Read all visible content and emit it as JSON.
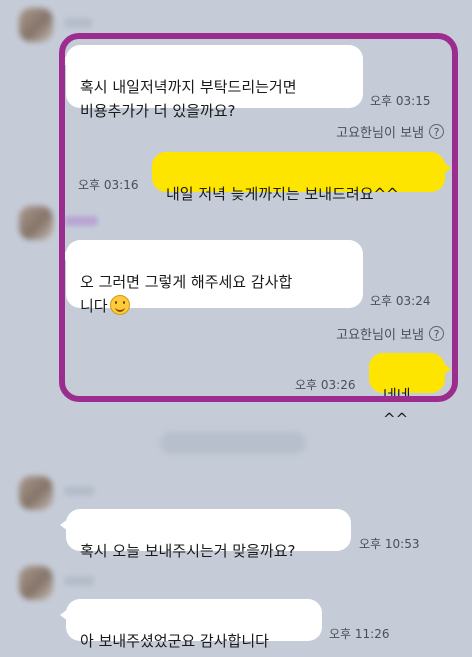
{
  "chat": {
    "messages": [
      {
        "sender": "other",
        "text": "혹시 내일저녁까지 부탁드리는거면\n비용추가가 더 있을까요?",
        "time": "오후 03:15"
      },
      {
        "sender": "me",
        "note": "고요한님이 보냄",
        "text": "내일 저녁 늦게까지는 보내드려요^^",
        "time": "오후 03:16"
      },
      {
        "sender": "other",
        "text": "오 그러면 그렇게 해주세요 감사합\n니다",
        "emoji": "smiling-face-emoji",
        "time": "오후 03:24"
      },
      {
        "sender": "me",
        "note": "고요한님이 보냄",
        "text": "네네^^",
        "time": "오후 03:26"
      },
      {
        "sender": "other",
        "text": "혹시 오늘 보내주시는거 맞을까요?",
        "time": "오후 10:53"
      },
      {
        "sender": "other",
        "text": "아 보내주셨었군요 감사합니다",
        "time": "오후 11:26"
      }
    ]
  },
  "icons": {
    "help": "question-circle-icon"
  },
  "colors": {
    "background": "#c5ccd8",
    "my_bubble": "#fee500",
    "other_bubble": "#ffffff",
    "highlight_border": "#9b2d8e"
  }
}
